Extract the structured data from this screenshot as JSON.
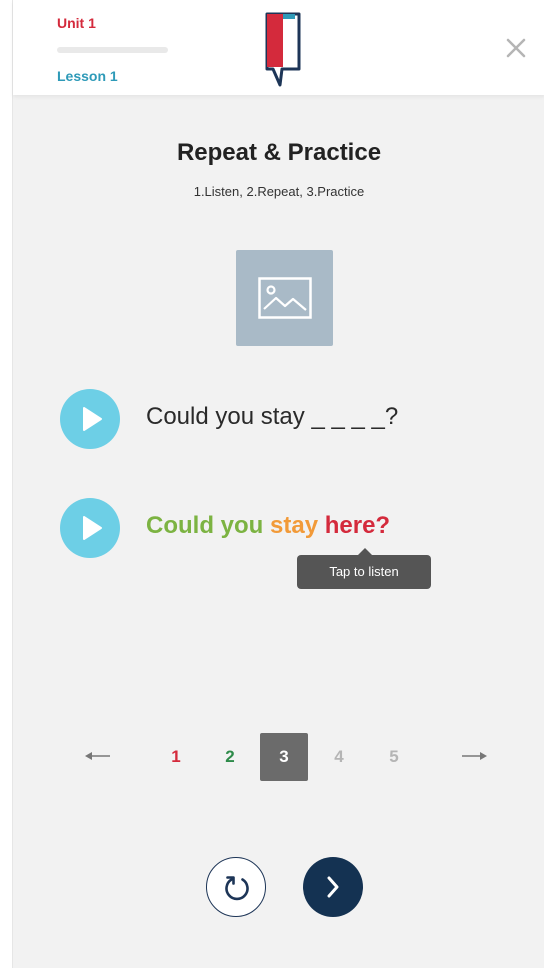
{
  "header": {
    "unit_label": "Unit 1",
    "lesson_label": "Lesson 1",
    "progress_fraction": 0.0
  },
  "exercise": {
    "title": "Repeat & Practice",
    "instructions": "1.Listen, 2.Repeat, 3.Practice",
    "prompt": {
      "text": "Could you stay",
      "blank": "_ _ _ _?"
    },
    "answer": {
      "words": [
        {
          "text": "Could you",
          "color": "#7cb342"
        },
        {
          "text": "stay",
          "color": "#f29a38"
        },
        {
          "text": "here?",
          "color": "#d42a3c"
        }
      ]
    },
    "tooltip": "Tap to listen"
  },
  "pager": {
    "prev_icon": "arrow-left-icon",
    "next_icon": "arrow-right-icon",
    "pages": [
      {
        "label": "1",
        "state": "incorrect",
        "color": "#d42a3c"
      },
      {
        "label": "2",
        "state": "correct",
        "color": "#2e8b4a"
      },
      {
        "label": "3",
        "state": "current"
      },
      {
        "label": "4",
        "state": "upcoming"
      },
      {
        "label": "5",
        "state": "upcoming"
      }
    ]
  },
  "controls": {
    "reset_icon": "refresh-icon",
    "next_icon": "chevron-right-icon"
  },
  "colors": {
    "brand_red": "#d42a3c",
    "brand_blue": "#2e9ab8",
    "play_button": "#6dcfe6",
    "navy": "#143252",
    "background": "#f2f2f2"
  }
}
